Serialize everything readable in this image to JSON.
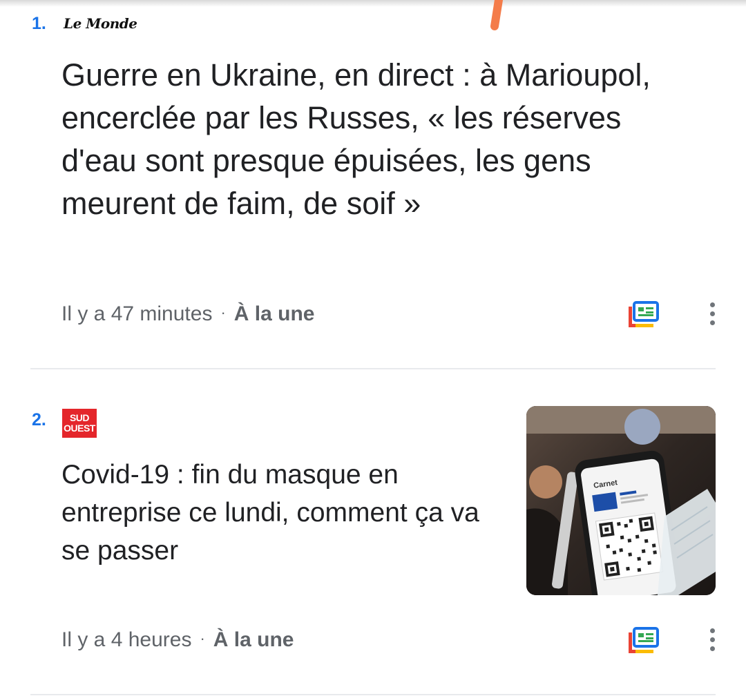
{
  "articles": [
    {
      "rank": "1.",
      "source": "Le Monde",
      "headline": "Guerre en Ukraine, en direct : à Marioupol, encerclée par les Russes, « les réserves d'eau sont presque épuisées, les gens meurent de faim, de soif »",
      "time": "Il y a 47 minutes",
      "separator": "·",
      "section": "À la une"
    },
    {
      "rank": "2.",
      "source": "SUD OUEST",
      "source_line1": "SUD",
      "source_line2": "OUEST",
      "headline": "Covid-19 : fin du masque en entreprise ce lundi, comment ça va se passer",
      "time": "Il y a 4 heures",
      "separator": "·",
      "section": "À la une",
      "thumbnail_text": "Carnet"
    }
  ],
  "icons": {
    "full_coverage": "full-coverage-icon",
    "more": "more-vert-icon"
  },
  "colors": {
    "rank": "#1a73e8",
    "headline": "#202124",
    "meta": "#5f6368",
    "sudouest": "#e4262b"
  }
}
